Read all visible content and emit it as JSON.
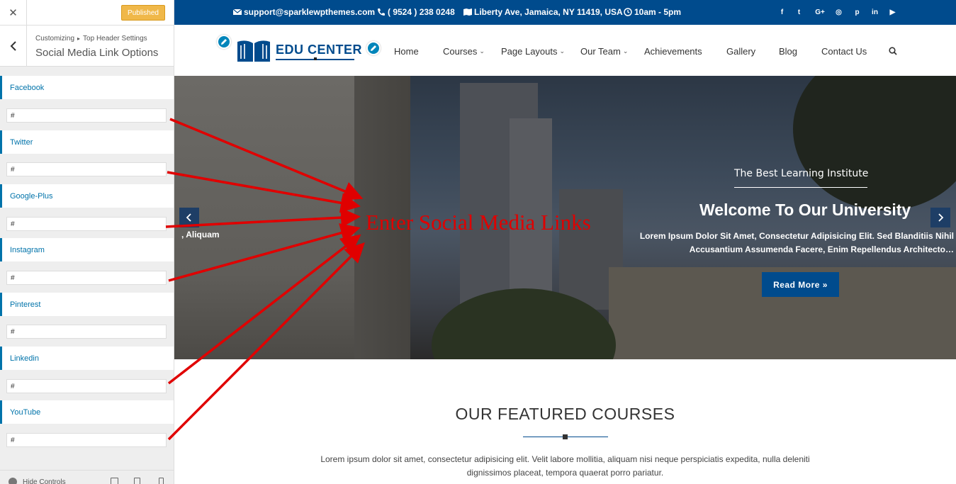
{
  "customizer": {
    "close_glyph": "✕",
    "publish_label": "Published",
    "breadcrumb": [
      "Customizing",
      "Top Header Settings"
    ],
    "breadcrumb_sep": "▸",
    "panel_title": "Social Media Link Options",
    "fields": [
      {
        "label": "Facebook",
        "value": "#"
      },
      {
        "label": "Twitter",
        "value": "#"
      },
      {
        "label": "Google-Plus",
        "value": "#"
      },
      {
        "label": "Instagram",
        "value": "#"
      },
      {
        "label": "Pinterest",
        "value": "#"
      },
      {
        "label": "Linkedin",
        "value": "#"
      },
      {
        "label": "YouTube",
        "value": "#"
      }
    ],
    "footer": {
      "hide_label": "Hide Controls"
    },
    "accent_color": "#0073aa",
    "publish_color": "#f0b849"
  },
  "site": {
    "topbar": {
      "email": "support@sparklewpthemes.com",
      "phone": "( 9524 ) 238 0248",
      "address": "Liberty Ave, Jamaica, NY 11419, USA",
      "hours": "10am - 5pm",
      "social_icons": [
        {
          "icon": "facebook-icon",
          "glyph": "f"
        },
        {
          "icon": "twitter-icon",
          "glyph": "t"
        },
        {
          "icon": "google-plus-icon",
          "glyph": "G+"
        },
        {
          "icon": "instagram-icon",
          "glyph": "◎"
        },
        {
          "icon": "pinterest-icon",
          "glyph": "p"
        },
        {
          "icon": "linkedin-icon",
          "glyph": "in"
        },
        {
          "icon": "youtube-icon",
          "glyph": "▶"
        }
      ],
      "bg_color": "#004b8d"
    },
    "logo_text": "EDU CENTER",
    "nav": [
      {
        "label": "Home",
        "dropdown": false
      },
      {
        "label": "Courses",
        "dropdown": true
      },
      {
        "label": "Page Layouts",
        "dropdown": true
      },
      {
        "label": "Our Team",
        "dropdown": true
      },
      {
        "label": "Achievements",
        "dropdown": false
      },
      {
        "label": "Gallery",
        "dropdown": false
      },
      {
        "label": "Blog",
        "dropdown": false
      },
      {
        "label": "Contact Us",
        "dropdown": false
      }
    ],
    "nav_chevron": "⌄",
    "hero": {
      "subtitle": "The Best Learning Institute",
      "title": "Welcome To Our University",
      "description": "Lorem Ipsum Dolor Sit Amet, Consectetur Adipisicing Elit. Sed Blanditiis Nihil Accusantium Assumenda Facere, Enim Repellendus Architecto…",
      "prev_slide_fragment": ", Aliquam",
      "button_label": "Read More »"
    },
    "featured": {
      "title": "OUR FEATURED COURSES",
      "description": "Lorem ipsum dolor sit amet, consectetur adipisicing elit. Velit labore mollitia, aliquam nisi neque perspiciatis expedita, nulla deleniti dignissimos placeat, tempora quaerat porro pariatur."
    }
  },
  "annotation": {
    "text": "Enter Social Media Links",
    "color": "#e00000"
  }
}
